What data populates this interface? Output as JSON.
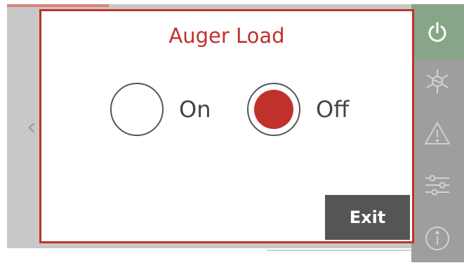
{
  "dialog": {
    "title": "Auger Load",
    "options": [
      {
        "label": "On",
        "selected": false
      },
      {
        "label": "Off",
        "selected": true
      }
    ],
    "exit_label": "Exit"
  },
  "background": {
    "nav_chevron": "‹"
  },
  "side_rail": {
    "icons": [
      "power-icon",
      "defrost-icon",
      "warning-icon",
      "settings-sliders-icon",
      "info-icon"
    ]
  },
  "colors": {
    "accent": "#c1312b",
    "exit_button": "#555555",
    "rail": "#9e9e9e",
    "rail_active": "#87a687"
  }
}
